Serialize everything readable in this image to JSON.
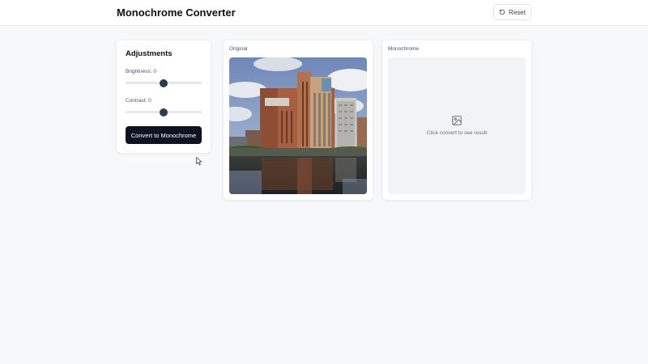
{
  "header": {
    "title": "Monochrome Converter",
    "reset_label": "Reset",
    "reset_icon": "rotate-ccw-icon"
  },
  "adjustments": {
    "title": "Adjustments",
    "brightness_label": "Brightness: 0",
    "brightness_value": 0,
    "contrast_label": "Contrast: 0",
    "contrast_value": 0,
    "convert_label": "Convert to Monochrome"
  },
  "original": {
    "label": "Original",
    "image": "photo of a tall brick riverside building reflected in water"
  },
  "monochrome": {
    "label": "Monochrome",
    "placeholder_icon": "image-icon",
    "placeholder_text": "Click convert to see result"
  },
  "colors": {
    "background": "#f7f8fa",
    "button_dark": "#0f1220",
    "slider_thumb": "#2f3a4c"
  }
}
